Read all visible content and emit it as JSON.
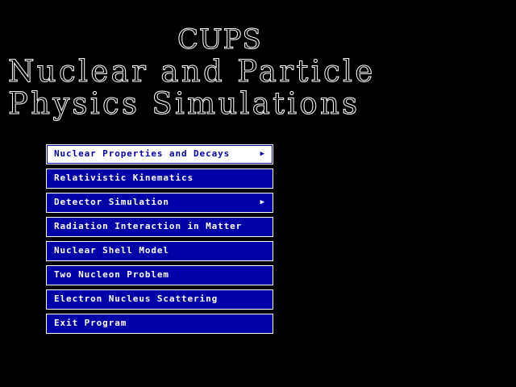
{
  "header": {
    "title_line1": "CUPS",
    "title_line2": "Nuclear and Particle",
    "title_line3": "Physics Simulations"
  },
  "menu": {
    "items": [
      {
        "label": "Nuclear Properties and Decays",
        "has_submenu": true,
        "selected": true,
        "arrow": "▶"
      },
      {
        "label": "Relativistic Kinematics",
        "has_submenu": false,
        "selected": false
      },
      {
        "label": "Detector Simulation",
        "has_submenu": true,
        "selected": false,
        "arrow": "▶"
      },
      {
        "label": "Radiation Interaction in Matter",
        "has_submenu": false,
        "selected": false
      },
      {
        "label": "Nuclear Shell Model",
        "has_submenu": false,
        "selected": false
      },
      {
        "label": "Two Nucleon Problem",
        "has_submenu": false,
        "selected": false
      },
      {
        "label": "Electron Nucleus Scattering",
        "has_submenu": false,
        "selected": false
      },
      {
        "label": "Exit Program",
        "has_submenu": false,
        "selected": false
      }
    ]
  },
  "colors": {
    "background": "#000000",
    "menu_bg": "#0000a8",
    "menu_text": "#ffffff",
    "selected_bg": "#ffffff",
    "selected_text": "#0000a8"
  },
  "icons": {
    "submenu_arrow": "chevron-right-icon"
  }
}
